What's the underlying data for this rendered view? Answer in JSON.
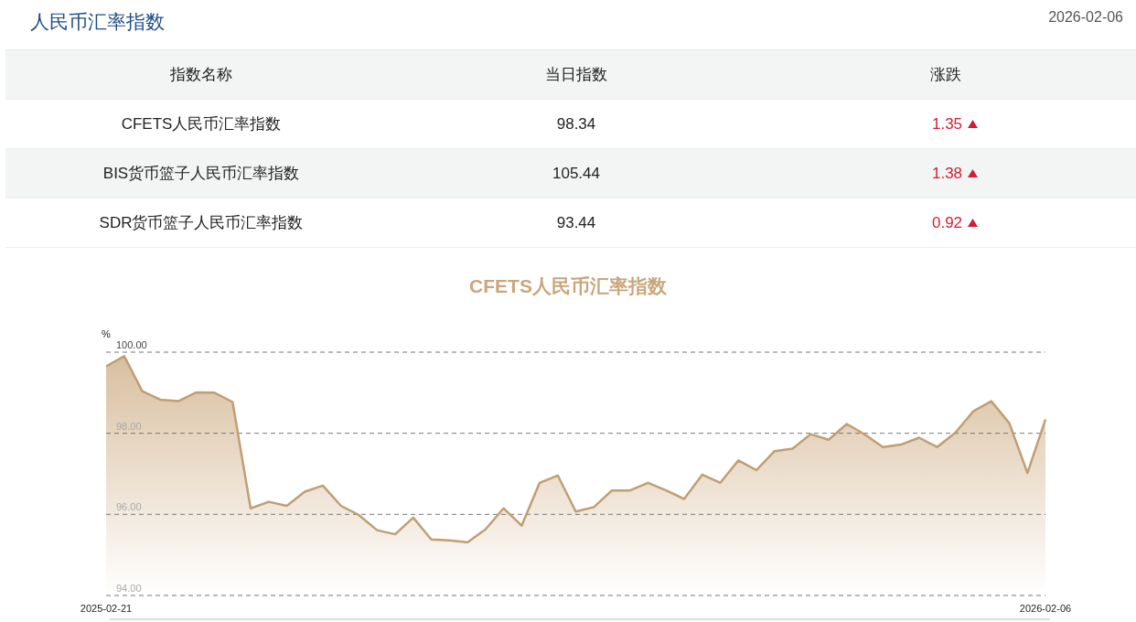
{
  "header": {
    "title": "人民币汇率指数",
    "date": "2026-02-06"
  },
  "table": {
    "columns": [
      "指数名称",
      "当日指数",
      "涨跌"
    ],
    "rows": [
      {
        "name": "CFETS人民币汇率指数",
        "value": "98.34",
        "change": "1.35",
        "kind": "up"
      },
      {
        "name": "BIS货币篮子人民币汇率指数",
        "value": "105.44",
        "change": "1.38",
        "kind": "up"
      },
      {
        "name": "SDR货币篮子人民币汇率指数",
        "value": "93.44",
        "change": "0.92",
        "kind": "up"
      }
    ]
  },
  "chart": {
    "chart_data": {
      "type": "area",
      "title": "CFETS人民币汇率指数",
      "ylabel": "%",
      "values": [
        99.65,
        99.9,
        99.04,
        98.83,
        98.79,
        99.01,
        99.0,
        98.77,
        96.15,
        96.31,
        96.21,
        96.56,
        96.71,
        96.21,
        95.98,
        95.61,
        95.51,
        95.92,
        95.38,
        95.36,
        95.31,
        95.63,
        96.15,
        95.72,
        96.78,
        96.96,
        96.07,
        96.18,
        96.59,
        96.59,
        96.78,
        96.59,
        96.38,
        96.98,
        96.78,
        97.33,
        97.09,
        97.56,
        97.62,
        97.98,
        97.84,
        98.23,
        97.97,
        97.66,
        97.72,
        97.89,
        97.66,
        98.01,
        98.54,
        98.79,
        98.25,
        97.02,
        98.34
      ],
      "ylim": [
        94,
        100
      ],
      "yticks": [
        {
          "value": 94,
          "label": "94.00"
        },
        {
          "value": 96,
          "label": "96.00"
        },
        {
          "value": 98,
          "label": "98.00"
        },
        {
          "value": 100,
          "label": "100.00"
        }
      ]
    },
    "start_date": "2025-02-21",
    "end_date": "2026-02-06"
  }
}
